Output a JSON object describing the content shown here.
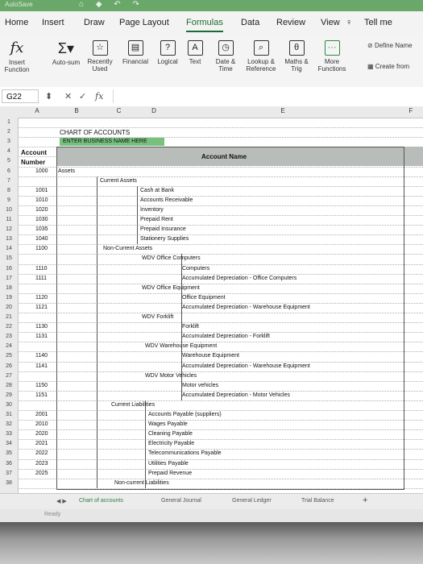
{
  "titlebar": {
    "autosave": "AutoSave"
  },
  "tabs": [
    "Home",
    "Insert",
    "Draw",
    "Page Layout",
    "Formulas",
    "Data",
    "Review",
    "View"
  ],
  "active_tab": "Formulas",
  "tell_me": "Tell me",
  "ribbon": {
    "insert_function": "Insert Function",
    "autosum": "Auto-sum",
    "recently_used": "Recently Used",
    "financial": "Financial",
    "logical": "Logical",
    "text": "Text",
    "date_time": "Date & Time",
    "lookup_reference": "Lookup & Reference",
    "maths_trig": "Maths & Trig",
    "more_functions": "More Functions",
    "define_name": "Define Name",
    "create_from": "Create from"
  },
  "formula_bar": {
    "name_box": "G22",
    "cancel": "✕",
    "enter": "✓",
    "fx": "fx"
  },
  "columns": [
    "A",
    "B",
    "C",
    "D",
    "E",
    "F"
  ],
  "rows": [
    "1",
    "2",
    "3",
    "4",
    "5",
    "6",
    "7",
    "8",
    "9",
    "10",
    "11",
    "12",
    "13",
    "14",
    "15",
    "16",
    "17",
    "18",
    "19",
    "20",
    "21",
    "22",
    "23",
    "24",
    "25",
    "26",
    "27",
    "28",
    "29",
    "30",
    "31",
    "32",
    "33",
    "34",
    "35",
    "36",
    "37",
    "38"
  ],
  "sheet": {
    "title": "CHART OF ACCOUNTS",
    "subtitle": "ENTER BUSINESS NAME HERE",
    "header_account_number": "Account Number",
    "header_account_name": "Account Name",
    "entries": [
      {
        "num": "1000",
        "label": "Assets"
      },
      {
        "num": "",
        "label": "Current Assets"
      },
      {
        "num": "1001",
        "label": "Cash at Bank"
      },
      {
        "num": "1010",
        "label": "Accounts Receivable"
      },
      {
        "num": "1020",
        "label": "Inventory"
      },
      {
        "num": "1030",
        "label": "Prepaid Rent"
      },
      {
        "num": "1035",
        "label": "Prepaid Insurance"
      },
      {
        "num": "1040",
        "label": "Stationery Supplies"
      },
      {
        "num": "1100",
        "label": "Non-Current Assets"
      },
      {
        "num": "",
        "label": "WDV Office Computers"
      },
      {
        "num": "1110",
        "label": "Computers"
      },
      {
        "num": "1111",
        "label": "Accumulated Depreciation - Office Computers"
      },
      {
        "num": "",
        "label": "WDV Office Equipment"
      },
      {
        "num": "1120",
        "label": "Office Equipment"
      },
      {
        "num": "1121",
        "label": "Accumulated Depreciation - Warehouse Equipment"
      },
      {
        "num": "",
        "label": "WDV Forklift"
      },
      {
        "num": "1130",
        "label": "Forklift"
      },
      {
        "num": "1131",
        "label": "Accumulated Depreciation - Forklift"
      },
      {
        "num": "",
        "label": "WDV Warehouse Equipment"
      },
      {
        "num": "1140",
        "label": "Warehouse Equipment"
      },
      {
        "num": "1141",
        "label": "Accumulated Depreciation - Warehouse Equipment"
      },
      {
        "num": "",
        "label": "WDV Motor Vehicles"
      },
      {
        "num": "1150",
        "label": "Motor vehicles"
      },
      {
        "num": "1151",
        "label": "Accumulated Depreciation - Motor Vehicles"
      },
      {
        "num": "",
        "label": "Current Liabilities"
      },
      {
        "num": "2001",
        "label": "Accounts Payable (suppliers)"
      },
      {
        "num": "2010",
        "label": "Wages Payable"
      },
      {
        "num": "2020",
        "label": "Cleaning Payable"
      },
      {
        "num": "2021",
        "label": "Electricity Payable"
      },
      {
        "num": "2022",
        "label": "Telecommunications Payable"
      },
      {
        "num": "2023",
        "label": "Utilities Payable"
      },
      {
        "num": "2025",
        "label": "Prepaid Revenue"
      },
      {
        "num": "",
        "label": "Non-current Liabilities"
      }
    ]
  },
  "sheet_tabs": [
    "Chart of accounts",
    "General Journal",
    "General Ledger",
    "Trial Balance"
  ],
  "add_sheet": "+",
  "status": "Ready",
  "colors": {
    "title_bar": "#6aa86a",
    "accent": "#1e6b32",
    "subtitle_fill": "#78c07e",
    "header_band": "#b9bdb9"
  }
}
